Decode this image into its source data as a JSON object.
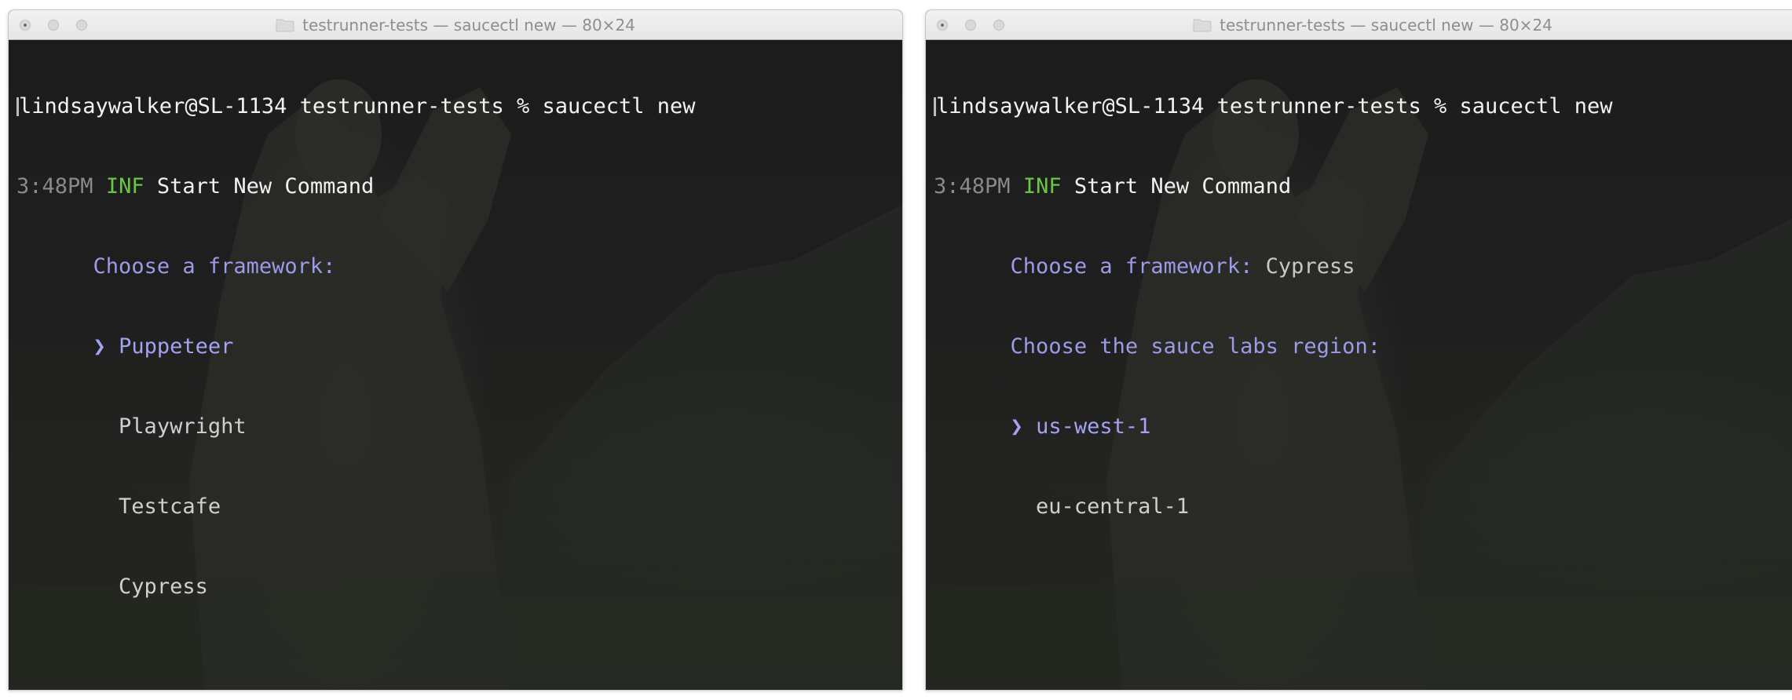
{
  "windows": [
    {
      "title": "testrunner-tests — saucectl new — 80×24",
      "command_line": "lindsaywalker@SL-1134 testrunner-tests % saucectl new",
      "log": {
        "time": "3:48PM",
        "level": "INF",
        "message": "Start New Command"
      },
      "question": "Choose a framework:",
      "selector": "❯",
      "options": [
        "Puppeteer",
        "Playwright",
        "Testcafe",
        "Cypress"
      ],
      "selected_option": "Puppeteer"
    },
    {
      "title": "testrunner-tests — saucectl new — 80×24",
      "command_line": "lindsaywalker@SL-1134 testrunner-tests % saucectl new",
      "log": {
        "time": "3:48PM",
        "level": "INF",
        "message": "Start New Command"
      },
      "answered_question": "Choose a framework:",
      "answered_value": "Cypress",
      "question": "Choose the sauce labs region:",
      "selector": "❯",
      "options": [
        "us-west-1",
        "eu-central-1"
      ],
      "selected_option": "us-west-1"
    }
  ],
  "colors": {
    "terminal_bg": "#1c1c1c",
    "text": "#f2f2f2",
    "timestamp": "#8a8a8a",
    "inf": "#6cc644",
    "prompt": "#9b9be8",
    "selected": "#a3a3f2",
    "option": "#cfcfcf"
  },
  "icons": [
    "folder-icon",
    "close-button-icon",
    "minimize-button-icon",
    "zoom-button-icon"
  ]
}
